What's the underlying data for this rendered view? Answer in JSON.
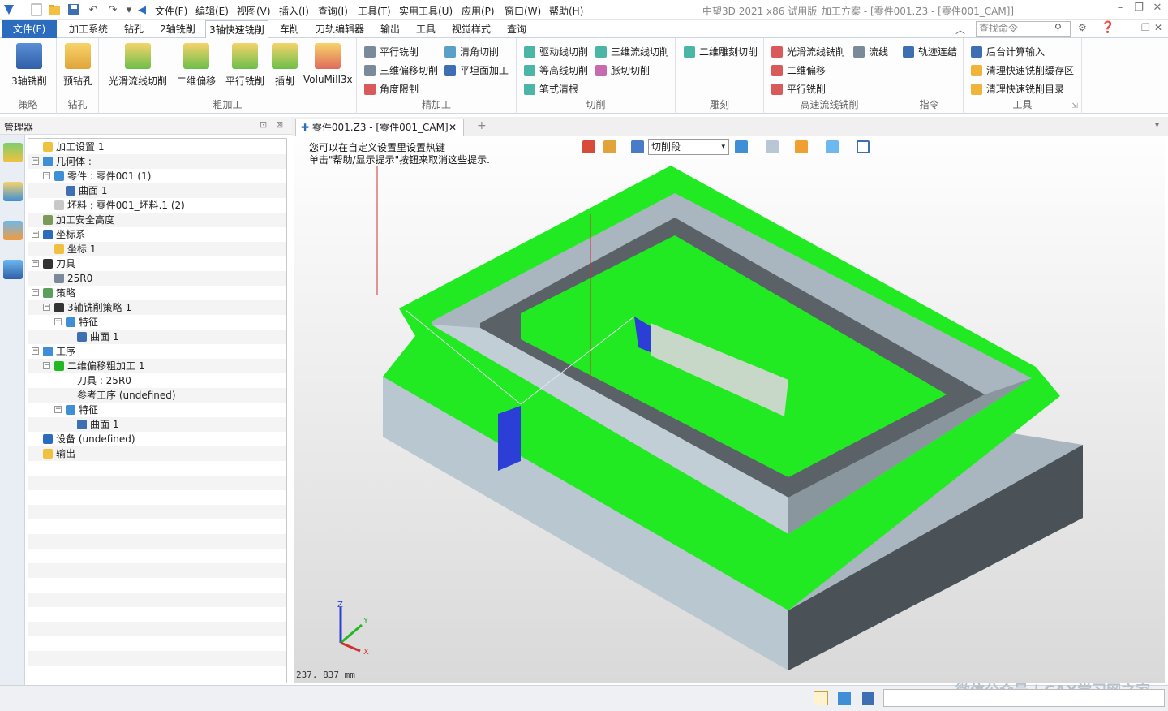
{
  "app": {
    "title_product": "中望3D 2021 x86 试用版",
    "title_doc": "加工方案 - [零件001.Z3 - [零件001_CAM]]"
  },
  "menu": [
    "文件(F)",
    "编辑(E)",
    "视图(V)",
    "插入(I)",
    "查询(I)",
    "工具(T)",
    "实用工具(U)",
    "应用(P)",
    "窗口(W)",
    "帮助(H)"
  ],
  "tabs": [
    "文件(F)",
    "加工系统",
    "钻孔",
    "2轴铣削",
    "3轴快速铣削",
    "车削",
    "刀轨编辑器",
    "输出",
    "工具",
    "视觉样式",
    "查询"
  ],
  "search_placeholder": "查找命令",
  "ribbon": {
    "strategy": {
      "big": "3轴铣削",
      "label": "策略"
    },
    "drill": {
      "big": "预钻孔",
      "label": "钻孔"
    },
    "rough": {
      "items": [
        "光滑流线切削",
        "二维偏移",
        "平行铣削",
        "插削",
        "VoluMill3x"
      ],
      "label": "粗加工"
    },
    "finish": {
      "items": [
        "平行铣削",
        "清角切削",
        "三维偏移切削",
        "平坦面加工",
        "角度限制"
      ],
      "label": "精加工"
    },
    "cut": {
      "items": [
        "驱动线切削",
        "三维流线切削",
        "等高线切削",
        "胀切切削",
        "笔式清根"
      ],
      "label": "切削"
    },
    "engrave": {
      "items": [
        "二维雕刻切削"
      ],
      "label": "雕刻"
    },
    "hsm": {
      "items": [
        "光滑流线铣削",
        "流线",
        "二维偏移",
        "平行铣削"
      ],
      "label": "高速流线铣削"
    },
    "cmd": {
      "items": [
        "轨迹连结"
      ],
      "label": "指令"
    },
    "tools": {
      "items": [
        "后台计算输入",
        "清理快速铣削缓存区",
        "清理快速铣削目录"
      ],
      "label": "工具"
    }
  },
  "manager_title": "管理器",
  "tree": [
    {
      "label": "加工设置 1"
    },
    {
      "label": "几何体 :"
    },
    {
      "label": "零件 : 零件001 (1)"
    },
    {
      "label": "曲面 1"
    },
    {
      "label": "坯料 : 零件001_坯料.1 (2)"
    },
    {
      "label": "加工安全高度"
    },
    {
      "label": "坐标系"
    },
    {
      "label": "坐标 1"
    },
    {
      "label": "刀具"
    },
    {
      "label": "25R0"
    },
    {
      "label": "策略"
    },
    {
      "label": "3轴铣削策略 1"
    },
    {
      "label": "特征"
    },
    {
      "label": "曲面 1"
    },
    {
      "label": "工序"
    },
    {
      "label": "二维偏移粗加工 1"
    },
    {
      "label": "刀具 : 25R0"
    },
    {
      "label": "参考工序 (undefined)"
    },
    {
      "label": "特征"
    },
    {
      "label": "曲面 1"
    },
    {
      "label": "设备 (undefined)"
    },
    {
      "label": "输出"
    }
  ],
  "doc_tab": "零件001.Z3 - [零件001_CAM]",
  "hint1": "您可以在自定义设置里设置热键",
  "hint2": "单击\"帮助/显示提示\"按钮来取消这些提示.",
  "segment_select": "切削段",
  "coord_readout": "237. 837  mm",
  "axis": {
    "z": "Z",
    "y": "Y",
    "x": "X"
  },
  "watermark": "微信公众号 | CAX学习网之家"
}
